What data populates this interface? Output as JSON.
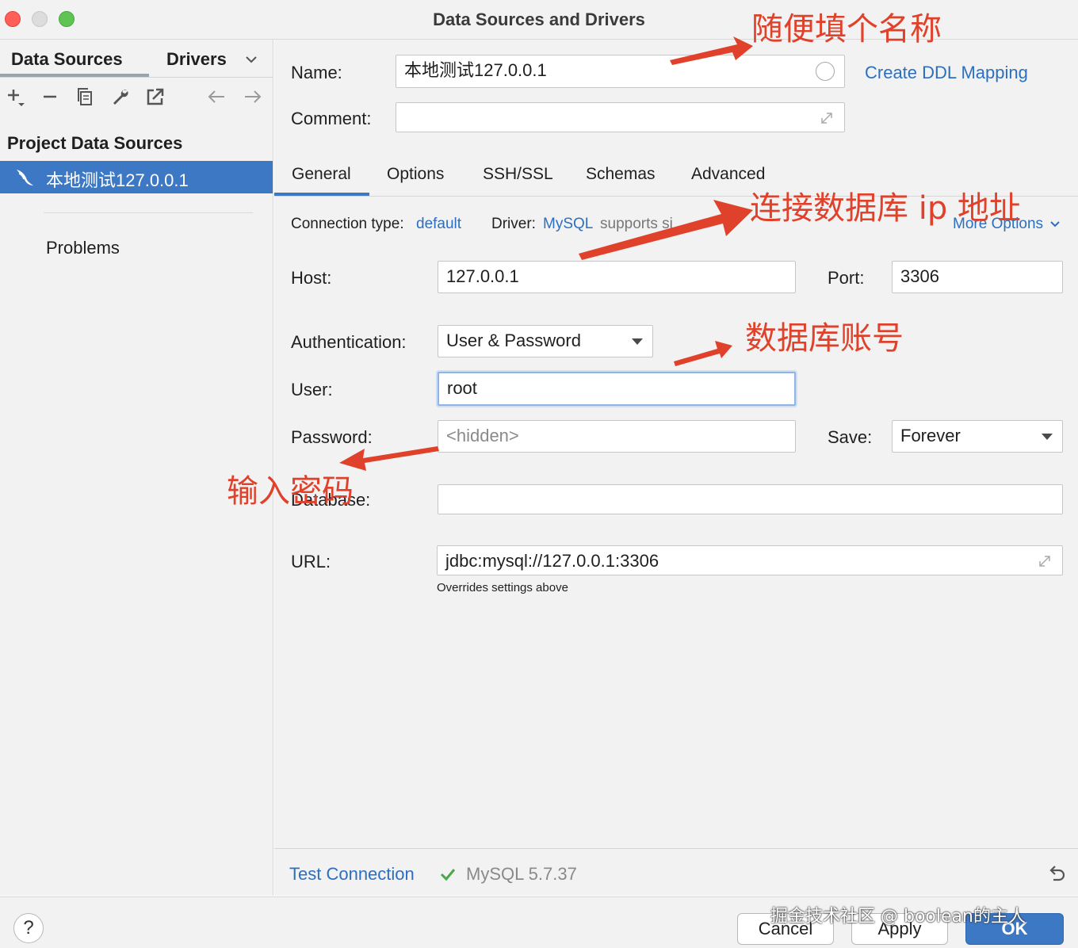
{
  "window": {
    "title": "Data Sources and Drivers"
  },
  "left": {
    "tabs": [
      "Data Sources",
      "Drivers"
    ],
    "section_title": "Project Data Sources",
    "selected_item": "本地测试127.0.0.1",
    "problems": "Problems"
  },
  "form": {
    "name_label": "Name:",
    "name_value": "本地测试127.0.0.1",
    "ddl_link": "Create DDL Mapping",
    "comment_label": "Comment:",
    "comment_value": "",
    "tabs": [
      "General",
      "Options",
      "SSH/SSL",
      "Schemas",
      "Advanced"
    ],
    "conn_type_label": "Connection type:",
    "conn_type_value": "default",
    "driver_label": "Driver:",
    "driver_value": "MySQL",
    "driver_note": "supports si",
    "more_options": "More Options",
    "host_label": "Host:",
    "host_value": "127.0.0.1",
    "port_label": "Port:",
    "port_value": "3306",
    "auth_label": "Authentication:",
    "auth_value": "User & Password",
    "user_label": "User:",
    "user_value": "root",
    "password_label": "Password:",
    "password_placeholder": "<hidden>",
    "save_label": "Save:",
    "save_value": "Forever",
    "database_label": "Database:",
    "database_value": "",
    "url_label": "URL:",
    "url_value": "jdbc:mysql://127.0.0.1:3306",
    "url_note": "Overrides settings above",
    "test_connection": "Test Connection",
    "test_result": "MySQL 5.7.37"
  },
  "footer": {
    "help": "?",
    "cancel": "Cancel",
    "apply": "Apply",
    "ok": "OK"
  },
  "annotations": {
    "name": "随便填个名称",
    "host": "连接数据库 ip 地址",
    "user": "数据库账号",
    "password": "输入密码",
    "color": "#e0412b"
  },
  "watermark": "掘金技术社区 @ boolean的主人",
  "colors": {
    "accent": "#3d78c4",
    "link": "#2c6fc0",
    "success": "#4aa84a"
  }
}
